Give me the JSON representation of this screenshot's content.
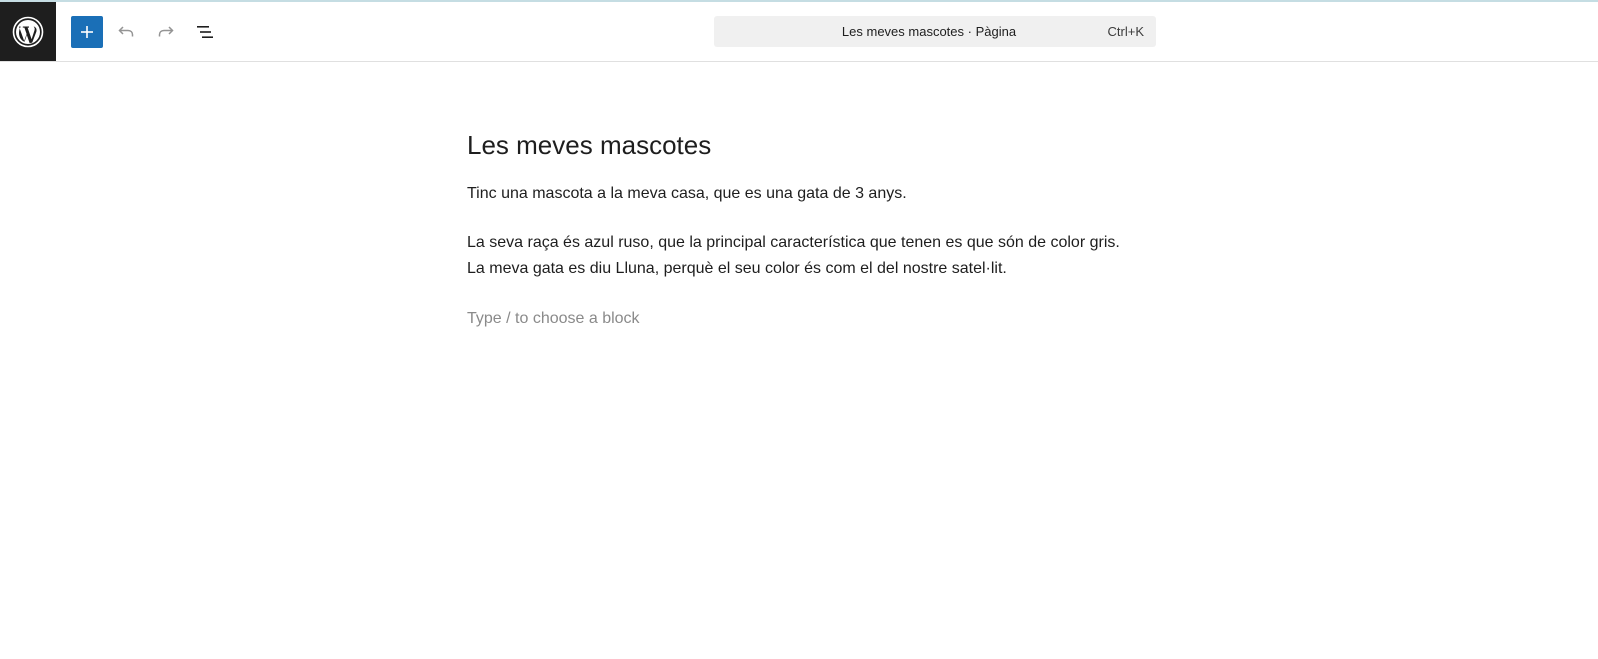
{
  "header": {
    "logo": "wordpress-logo",
    "add_block_icon": "plus-icon",
    "undo_icon": "undo-icon",
    "redo_icon": "redo-icon",
    "list_view_icon": "list-view-icon",
    "command_bar": {
      "title": "Les meves mascotes · Pàgina",
      "shortcut": "Ctrl+K"
    }
  },
  "editor": {
    "title": "Les meves mascotes",
    "paragraph1": "Tinc una mascota a la meva casa, que es una gata de 3 anys.",
    "paragraph2_line1": "La seva raça és azul ruso, que la principal característica que tenen es que són de color gris.",
    "paragraph2_line2": "La meva gata es diu Lluna, perquè el seu color és com el del nostre satel·lit.",
    "block_placeholder": "Type / to choose a block"
  },
  "colors": {
    "accent": "#1a6fb7",
    "logo_bg": "#1e1e1e",
    "command_bar_bg": "#f0f0f0",
    "placeholder_text": "#8a8a8a"
  }
}
